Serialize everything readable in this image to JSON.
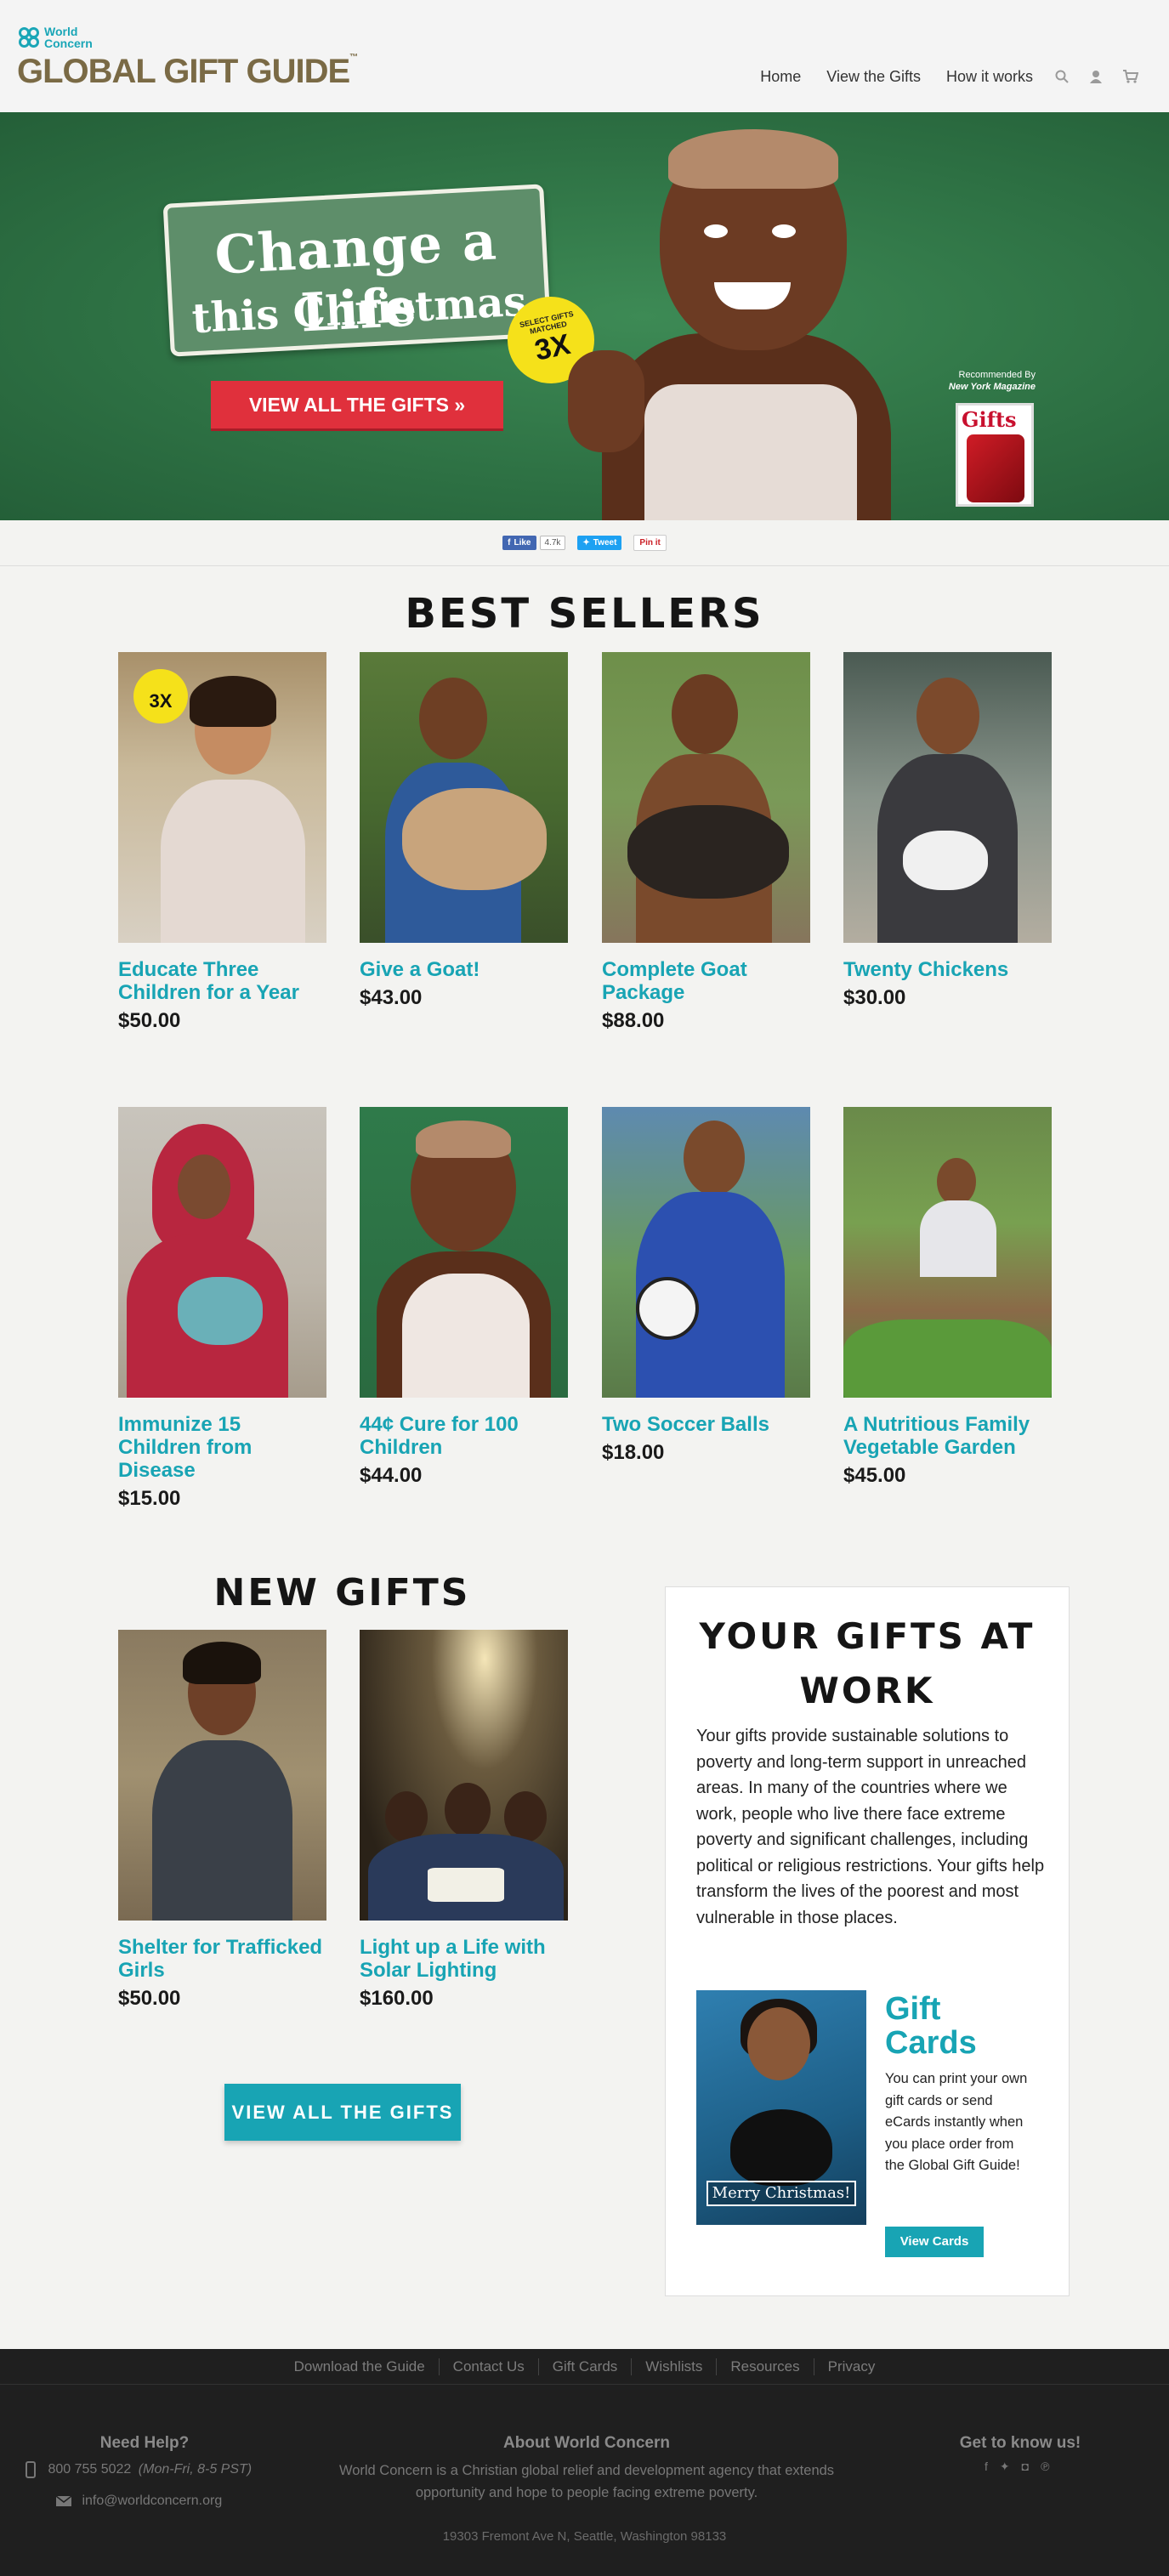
{
  "header": {
    "org_name": "World Concern",
    "site_title": "GLOBAL GIFT GUIDE",
    "trademark": "™",
    "nav": [
      {
        "label": "Home"
      },
      {
        "label": "View the Gifts"
      },
      {
        "label": "How it works"
      }
    ],
    "icons": [
      "search-icon",
      "user-icon",
      "cart-icon"
    ]
  },
  "hero": {
    "headline_line1": "Change a Life",
    "headline_line2": "this Christmas",
    "badge_small": "SELECT GIFTS MATCHED",
    "badge_big": "3X",
    "cta": "VIEW ALL THE GIFTS »",
    "recommended_label": "Recommended By",
    "recommended_by": "New York Magazine",
    "magazine_title": "Gifts"
  },
  "share": {
    "like": "Like",
    "like_count": "4.7k",
    "tweet": "Tweet",
    "pin": "Pin it"
  },
  "best_sellers": {
    "title": "BEST SELLERS",
    "items": [
      {
        "name": "Educate Three Children for a Year",
        "price": "$50.00",
        "badge": "3X"
      },
      {
        "name": "Give a Goat!",
        "price": "$43.00"
      },
      {
        "name": "Complete Goat Package",
        "price": "$88.00"
      },
      {
        "name": "Twenty Chickens",
        "price": "$30.00"
      },
      {
        "name": "Immunize 15 Children from Disease",
        "price": "$15.00"
      },
      {
        "name": "44¢ Cure for 100 Children",
        "price": "$44.00"
      },
      {
        "name": "Two Soccer Balls",
        "price": "$18.00"
      },
      {
        "name": "A Nutritious Family Vegetable Garden",
        "price": "$45.00"
      }
    ]
  },
  "new_gifts": {
    "title": "NEW GIFTS",
    "items": [
      {
        "name": "Shelter for Trafficked Girls",
        "price": "$50.00"
      },
      {
        "name": "Light up a Life with Solar Lighting",
        "price": "$160.00"
      }
    ],
    "view_all": "VIEW ALL THE GIFTS"
  },
  "gifts_at_work": {
    "title": "YOUR GIFTS AT WORK",
    "text": "Your gifts provide sustainable solutions to poverty and long-term support in unreached areas. In many of the countries where we work, people who live there face extreme poverty and significant challenges, including political or religious restrictions. Your gifts help transform the lives of the poorest and most vulnerable in those places.",
    "gift_cards_title": "Gift Cards",
    "gift_cards_text": "You can print your own gift cards or send eCards instantly when you place order from the Global Gift Guide!",
    "gift_cards_image_text": "Merry Christmas!",
    "gift_cards_button": "View Cards"
  },
  "footer": {
    "links": [
      "Download the Guide",
      "Contact Us",
      "Gift Cards",
      "Wishlists",
      "Resources",
      "Privacy"
    ],
    "help_title": "Need Help?",
    "phone": "800 755 5022",
    "phone_hours": "(Mon-Fri, 8-5 PST)",
    "email": "info@worldconcern.org",
    "about_title": "About World Concern",
    "about_text": "World Concern is a Christian global relief and development agency that extends opportunity and hope to people facing extreme poverty.",
    "address": "19303 Fremont Ave N, Seattle, Washington 98133",
    "social_title": "Get to know us!",
    "social_icons": [
      "facebook-icon",
      "twitter-icon",
      "instagram-icon",
      "pinterest-icon"
    ]
  },
  "colors": {
    "accent": "#18a4b4",
    "hero_green": "#2d7043",
    "cta_red": "#e0303c",
    "badge_yellow": "#f5e11a",
    "logo_brown": "#7a6a45",
    "footer_bg": "#1f1f1f"
  }
}
